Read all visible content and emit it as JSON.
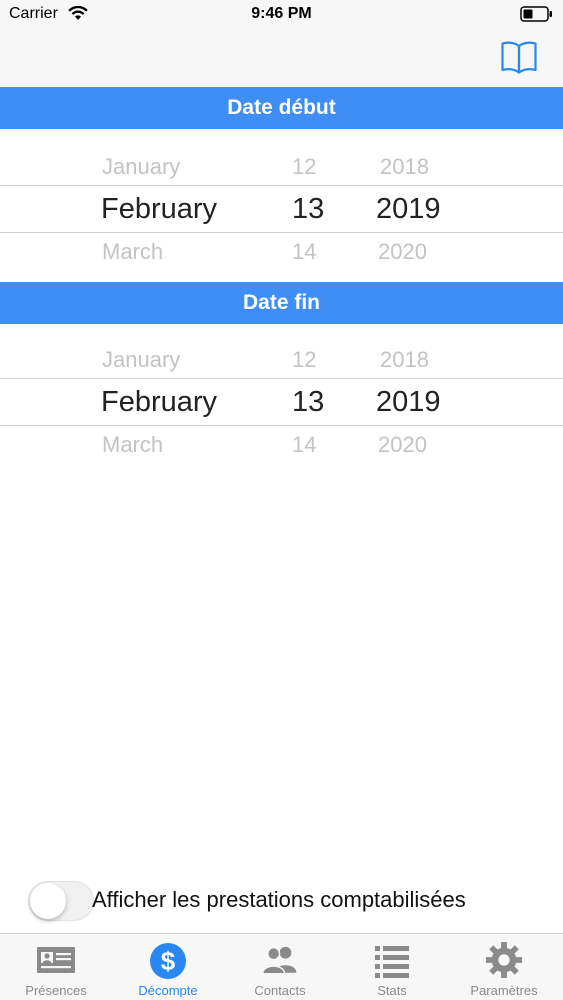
{
  "status_bar": {
    "carrier": "Carrier",
    "time": "9:46 PM"
  },
  "nav": {
    "book_icon": "book-open-icon"
  },
  "colors": {
    "accent": "#3e8ef6",
    "tab_active": "#2a87f0",
    "tab_inactive": "#8a8a8a"
  },
  "start_date": {
    "header": "Date début",
    "months": [
      "January",
      "February",
      "March"
    ],
    "days": [
      "12",
      "13",
      "14"
    ],
    "years": [
      "2018",
      "2019",
      "2020"
    ]
  },
  "end_date": {
    "header": "Date fin",
    "months": [
      "January",
      "February",
      "March"
    ],
    "days": [
      "12",
      "13",
      "14"
    ],
    "years": [
      "2018",
      "2019",
      "2020"
    ]
  },
  "toggle": {
    "label": "Afficher les prestations comptabilisées",
    "on": false
  },
  "tabs": [
    {
      "label": "Présences",
      "icon": "id-card-icon",
      "active": false
    },
    {
      "label": "Décompte",
      "icon": "dollar-icon",
      "active": true
    },
    {
      "label": "Contacts",
      "icon": "contacts-icon",
      "active": false
    },
    {
      "label": "Stats",
      "icon": "list-icon",
      "active": false
    },
    {
      "label": "Paramètres",
      "icon": "gear-icon",
      "active": false
    }
  ]
}
